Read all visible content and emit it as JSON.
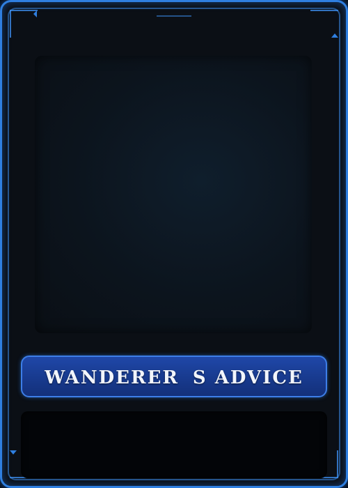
{
  "card": {
    "title": "WANDERERS ADVICE",
    "description": ""
  },
  "colors": {
    "frame_glow": "#2f7fe0",
    "banner_fill": "#1a3d93",
    "banner_border": "#3d7ee8",
    "card_background": "#0b0f15",
    "title_text": "#f2f5fb"
  }
}
